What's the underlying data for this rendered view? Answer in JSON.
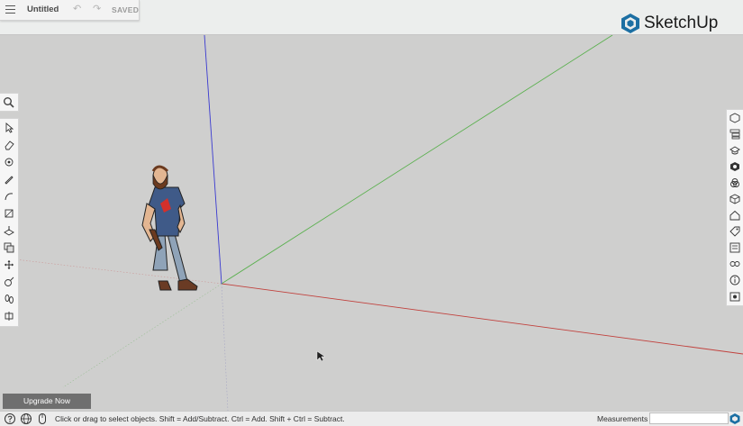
{
  "app": {
    "brand": "SketchUp",
    "logo_color": "#1c6fa3"
  },
  "file": {
    "title": "Untitled",
    "status": "SAVED"
  },
  "toolbar": {
    "menu_icon": "hamburger-icon",
    "undo_icon": "undo-icon",
    "redo_icon": "redo-icon"
  },
  "left_tools": [
    {
      "name": "select-icon"
    },
    {
      "name": "eraser-icon"
    },
    {
      "name": "tape-measure-icon"
    },
    {
      "name": "pencil-line-icon"
    },
    {
      "name": "arc-icon"
    },
    {
      "name": "rectangle-icon"
    },
    {
      "name": "push-pull-icon"
    },
    {
      "name": "offset-icon"
    },
    {
      "name": "move-icon"
    },
    {
      "name": "rotate-icon"
    },
    {
      "name": "footprints-icon"
    },
    {
      "name": "walk-icon"
    }
  ],
  "right_tools": [
    {
      "name": "entity-info-icon"
    },
    {
      "name": "components-icon"
    },
    {
      "name": "instructor-icon"
    },
    {
      "name": "materials-icon"
    },
    {
      "name": "styles-icon"
    },
    {
      "name": "scenes-icon"
    },
    {
      "name": "warehouse-icon"
    },
    {
      "name": "tags-icon"
    },
    {
      "name": "outliner-icon"
    },
    {
      "name": "display-icon"
    },
    {
      "name": "info-icon"
    },
    {
      "name": "solar-icon"
    }
  ],
  "viewport": {
    "axes": {
      "red": "#c1413d",
      "green": "#5ab04e",
      "blue": "#3a3ad0"
    },
    "background": "#cfcfce"
  },
  "upgrade": {
    "label": "Upgrade Now"
  },
  "status": {
    "hint": "Click or drag to select objects. Shift = Add/Subtract. Ctrl = Add. Shift + Ctrl = Subtract.",
    "measurements_label": "Measurements",
    "measurements_value": ""
  }
}
